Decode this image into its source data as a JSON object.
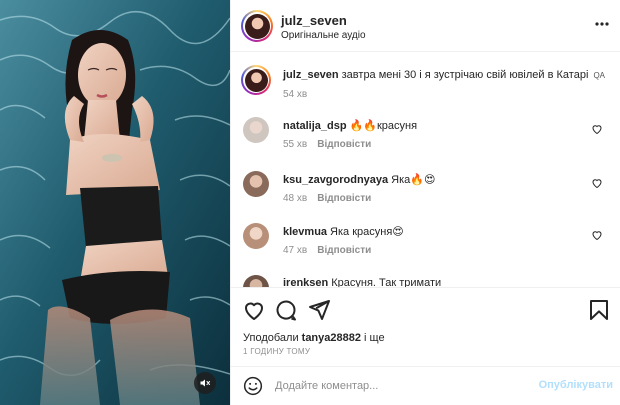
{
  "post": {
    "username": "julz_seven",
    "audio": "Оригінальне аудіо",
    "caption_user": "julz_seven",
    "caption_text": "завтра мені 30 і я зустрічаю свій ювілей в Катарі",
    "caption_flag": "QA",
    "caption_time": "54 хв"
  },
  "comments": [
    {
      "user": "natalija_dsp",
      "text": "🔥🔥красуня",
      "time": "55 хв",
      "reply": "Відповісти"
    },
    {
      "user": "ksu_zavgorodnyaya",
      "text": "Яка🔥😍",
      "time": "48 хв",
      "reply": "Відповісти"
    },
    {
      "user": "klevmua",
      "text": "Яка красуня😍",
      "time": "47 хв",
      "reply": "Відповісти"
    },
    {
      "user": "irenksen",
      "text": "Красуня. Так тримати",
      "time": "",
      "reply": ""
    }
  ],
  "likes": {
    "prefix": "Уподобали",
    "user": "tanya28882",
    "suffix": "і ще"
  },
  "timestamp": "1 ГОДИНУ ТОМУ",
  "add_comment": {
    "placeholder": "Додайте коментар...",
    "publish": "Опублікувати"
  },
  "icons": {
    "more": "more-horizontal-icon",
    "like": "heart-icon",
    "comment": "comment-bubble-icon",
    "share": "share-paper-plane-icon",
    "save": "bookmark-icon",
    "emoji": "smiley-icon",
    "mute": "speaker-muted-icon"
  },
  "colors": {
    "publish_disabled": "#b2dffc",
    "muted_text": "#8e8e8e",
    "text": "#262626"
  }
}
